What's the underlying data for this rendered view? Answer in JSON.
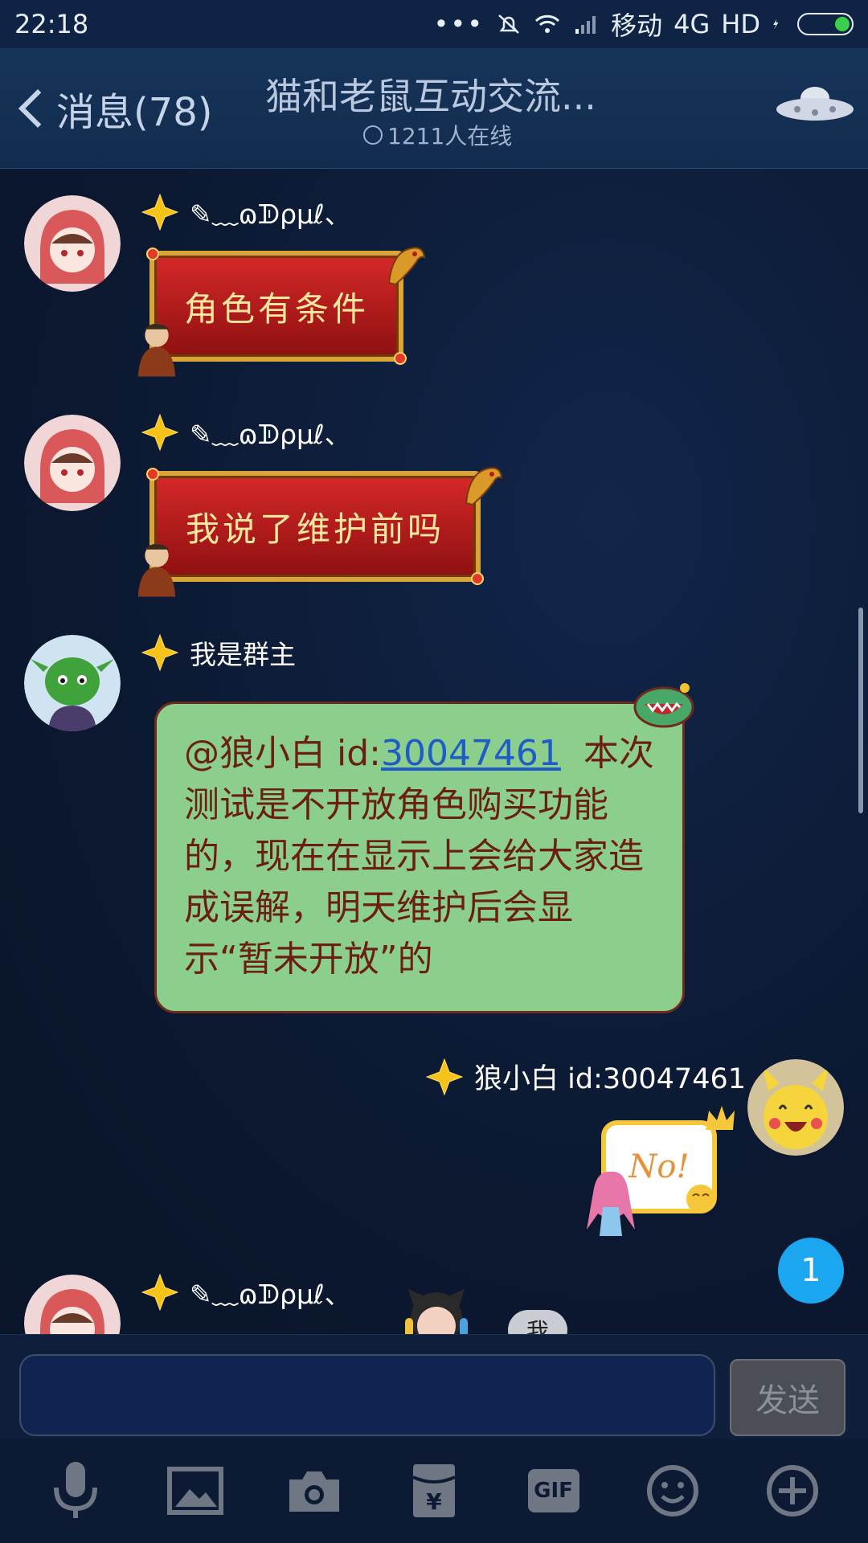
{
  "statusbar": {
    "time": "22:18",
    "carrier": "移动",
    "network": "4G",
    "hd": "HD"
  },
  "header": {
    "back_label": "消息(78)",
    "title": "猫和老鼠互动交流...",
    "online": "1211人在线"
  },
  "messages": [
    {
      "sender": "✎﹏ɷᗫρμℓ、",
      "text": "角色有条件"
    },
    {
      "sender": "✎﹏ɷᗫρμℓ、",
      "text": "我说了维护前吗"
    },
    {
      "sender": "我是群主",
      "mention": "@狼小白 id:",
      "mention_id": "30047461",
      "text": "本次测试是不开放角色购买功能的，现在在显示上会给大家造成误解，明天维护后会显示“暂未开放”的"
    },
    {
      "sender": "狼小白 id:30047461",
      "sticker_text": "No!"
    },
    {
      "sender": "✎﹏ɷᗫρμℓ、"
    }
  ],
  "unread_count": "1",
  "me_tag": "我",
  "input": {
    "send_label": "发送"
  },
  "toolbar": {
    "gif_label": "GIF"
  },
  "colors": {
    "accent": "#1ba7f0",
    "green_bubble": "#8ccf8d",
    "red_bubble": "#c21d1d"
  }
}
